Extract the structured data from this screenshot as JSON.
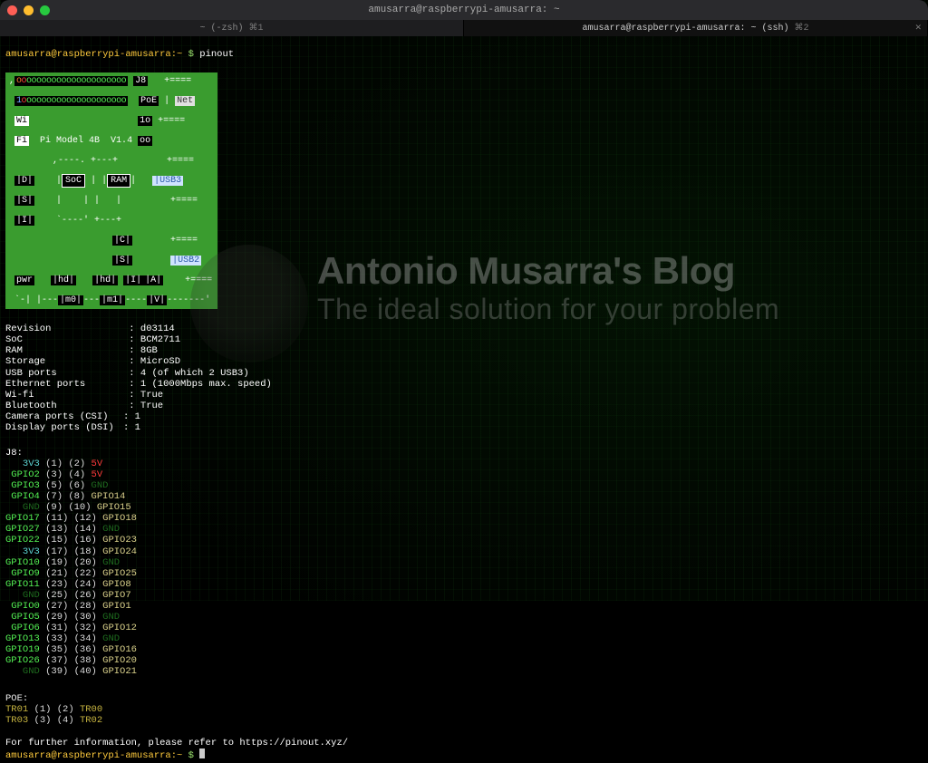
{
  "window": {
    "title": "amusarra@raspberrypi-amusarra: ~"
  },
  "tabs": [
    {
      "label": "~ (-zsh)",
      "badge": "⌘1",
      "active": false
    },
    {
      "label": "amusarra@raspberrypi-amusarra: ~ (ssh)",
      "badge": "⌘2",
      "active": true
    }
  ],
  "prompt": {
    "user_host": "amusarra@raspberrypi-amusarra:",
    "cwd": "~",
    "symbol": "$",
    "command": "pinout"
  },
  "board": {
    "gpio_strip": {
      "left_o": "oooooooooooooooooooo",
      "row2": "1ooooooooooooooooooo"
    },
    "j8": "J8",
    "poe": "PoE",
    "poe_10": "1o",
    "poe_oo": "oo",
    "wi": "Wi",
    "fi": "Fi",
    "model": "Pi Model 4B  V1.4",
    "soc": "SoC",
    "ram": "RAM",
    "usb3": "|USB3",
    "usb2": "|USB2",
    "net": "Net",
    "dsi": "|D|\n|S|\n|I|",
    "csi": "|C|\n|S|\n|I|",
    "av": "|A|\n|V|",
    "pwr": "pwr",
    "hd": "|hd",
    "m0": "|m0|",
    "m1": "|m1|"
  },
  "info": {
    "Revision": "d03114",
    "SoC": "BCM2711",
    "RAM": "8GB",
    "Storage": "MicroSD",
    "USB ports": "4 (of which 2 USB3)",
    "Ethernet ports": "1 (1000Mbps max. speed)",
    "Wi-fi": "True",
    "Bluetooth": "True",
    "Camera ports (CSI)": "1",
    "Display ports (DSI)": "1"
  },
  "j8_header": "J8:",
  "pins": [
    {
      "l": "3V3",
      "lc": "p-cyan",
      "ln": "1",
      "rn": "2",
      "r": "5V",
      "rc": "p-red"
    },
    {
      "l": "GPIO2",
      "lc": "p-grn",
      "ln": "3",
      "rn": "4",
      "r": "5V",
      "rc": "p-red"
    },
    {
      "l": "GPIO3",
      "lc": "p-grn",
      "ln": "5",
      "rn": "6",
      "r": "GND",
      "rc": "p-dgrn"
    },
    {
      "l": "GPIO4",
      "lc": "p-grn",
      "ln": "7",
      "rn": "8",
      "r": "GPIO14",
      "rc": "p-cream"
    },
    {
      "l": "GND",
      "lc": "p-dgrn",
      "ln": "9",
      "rn": "10",
      "r": "GPIO15",
      "rc": "p-cream"
    },
    {
      "l": "GPIO17",
      "lc": "p-grn",
      "ln": "11",
      "rn": "12",
      "r": "GPIO18",
      "rc": "p-cream"
    },
    {
      "l": "GPIO27",
      "lc": "p-grn",
      "ln": "13",
      "rn": "14",
      "r": "GND",
      "rc": "p-dgrn"
    },
    {
      "l": "GPIO22",
      "lc": "p-grn",
      "ln": "15",
      "rn": "16",
      "r": "GPIO23",
      "rc": "p-cream"
    },
    {
      "l": "3V3",
      "lc": "p-cyan",
      "ln": "17",
      "rn": "18",
      "r": "GPIO24",
      "rc": "p-cream"
    },
    {
      "l": "GPIO10",
      "lc": "p-grn",
      "ln": "19",
      "rn": "20",
      "r": "GND",
      "rc": "p-dgrn"
    },
    {
      "l": "GPIO9",
      "lc": "p-grn",
      "ln": "21",
      "rn": "22",
      "r": "GPIO25",
      "rc": "p-cream"
    },
    {
      "l": "GPIO11",
      "lc": "p-grn",
      "ln": "23",
      "rn": "24",
      "r": "GPIO8",
      "rc": "p-cream"
    },
    {
      "l": "GND",
      "lc": "p-dgrn",
      "ln": "25",
      "rn": "26",
      "r": "GPIO7",
      "rc": "p-cream"
    },
    {
      "l": "GPIO0",
      "lc": "p-grn",
      "ln": "27",
      "rn": "28",
      "r": "GPIO1",
      "rc": "p-cream"
    },
    {
      "l": "GPIO5",
      "lc": "p-grn",
      "ln": "29",
      "rn": "30",
      "r": "GND",
      "rc": "p-dgrn"
    },
    {
      "l": "GPIO6",
      "lc": "p-grn",
      "ln": "31",
      "rn": "32",
      "r": "GPIO12",
      "rc": "p-cream"
    },
    {
      "l": "GPIO13",
      "lc": "p-grn",
      "ln": "33",
      "rn": "34",
      "r": "GND",
      "rc": "p-dgrn"
    },
    {
      "l": "GPIO19",
      "lc": "p-grn",
      "ln": "35",
      "rn": "36",
      "r": "GPIO16",
      "rc": "p-cream"
    },
    {
      "l": "GPIO26",
      "lc": "p-grn",
      "ln": "37",
      "rn": "38",
      "r": "GPIO20",
      "rc": "p-cream"
    },
    {
      "l": "GND",
      "lc": "p-dgrn",
      "ln": "39",
      "rn": "40",
      "r": "GPIO21",
      "rc": "p-cream"
    }
  ],
  "poe_header": "POE:",
  "poe_pins": [
    {
      "l": "TR01",
      "ln": "1",
      "rn": "2",
      "r": "TR00"
    },
    {
      "l": "TR03",
      "ln": "3",
      "rn": "4",
      "r": "TR02"
    }
  ],
  "footer_msg": "For further information, please refer to https://pinout.xyz/",
  "watermark": {
    "title": "Antonio Musarra's Blog",
    "subtitle": "The ideal solution for your problem"
  }
}
